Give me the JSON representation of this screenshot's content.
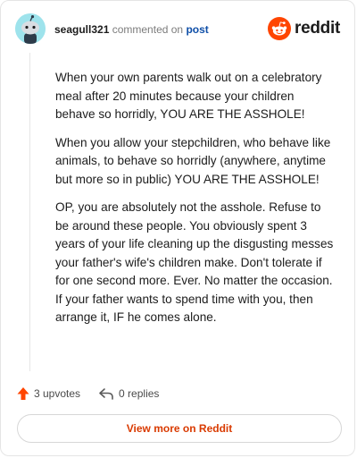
{
  "comment": {
    "username": "seagull321",
    "action_text": "commented on",
    "post_link": "post",
    "avatar": {
      "icon": "snoo-avatar-icon",
      "background": "#9ee3ec"
    },
    "paragraphs": [
      "When your own parents walk out on a celebratory meal after 20 minutes because your children behave so horridly, YOU ARE THE ASSHOLE!",
      "When you allow your stepchildren, who behave like animals, to behave so horridly (anywhere, anytime but more so in public) YOU ARE THE ASSHOLE!",
      "OP, you are absolutely not the asshole. Refuse to be around these people. You obviously spent 3 years of your life cleaning up the disgusting messes your father's wife's children make. Don't tolerate if for one second more. Ever. No matter the occasion. If your father wants to spend time with you, then arrange it, IF he comes alone."
    ]
  },
  "brand": {
    "name": "reddit",
    "logo_icon": "reddit-logo-icon",
    "color": "#ff4500"
  },
  "actions": {
    "upvotes": "3 upvotes",
    "upvote_icon": "upvote-arrow-icon",
    "upvote_color": "#ff4500",
    "replies": "0 replies",
    "reply_icon": "reply-arrow-icon"
  },
  "footer": {
    "view_button": "View more on Reddit",
    "button_color": "#d93a00"
  }
}
